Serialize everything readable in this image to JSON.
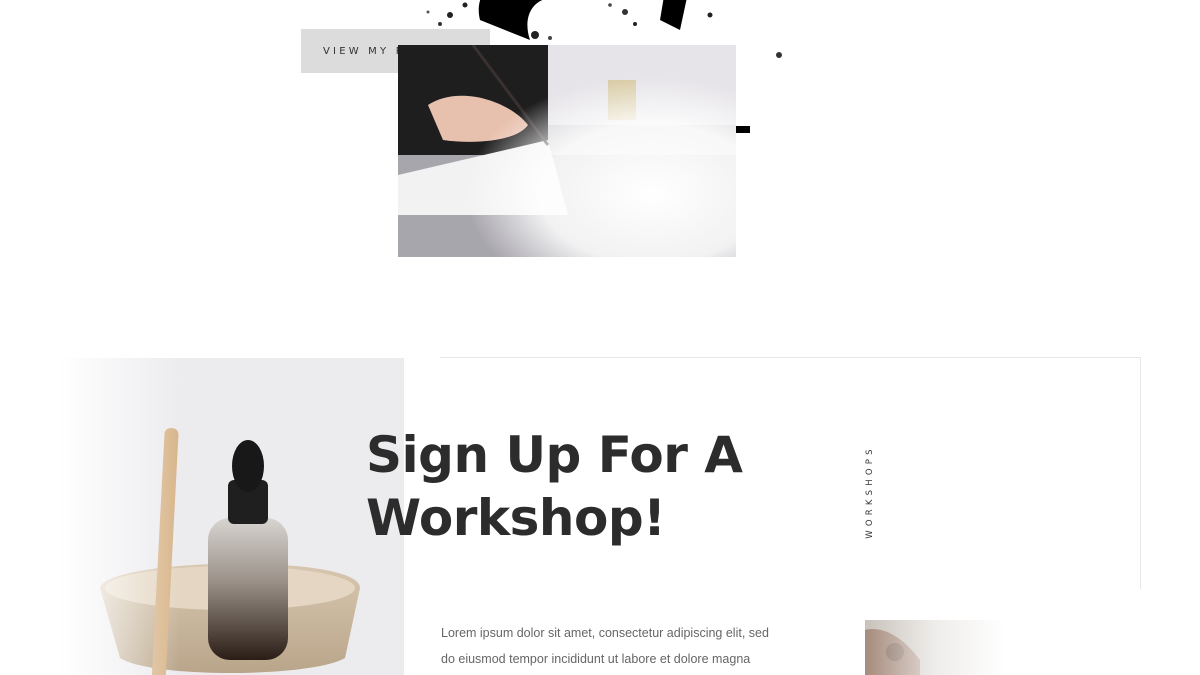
{
  "hero": {
    "button_label": "VIEW MY PORTFOLIO"
  },
  "workshop": {
    "headline_line1": "Sign Up For A",
    "headline_line2": "Workshop!",
    "vertical_label": "WORKSHOPS",
    "body_line1": "Lorem ipsum dolor sit amet, consectetur adipiscing elit, sed",
    "body_line2": "do eiusmod tempor incididunt ut labore et dolore magna"
  },
  "colors": {
    "heading": "#2c2c2c",
    "button_bg": "#dcdcdc",
    "body_text": "#666666",
    "frame_line": "#e6e6e6"
  }
}
